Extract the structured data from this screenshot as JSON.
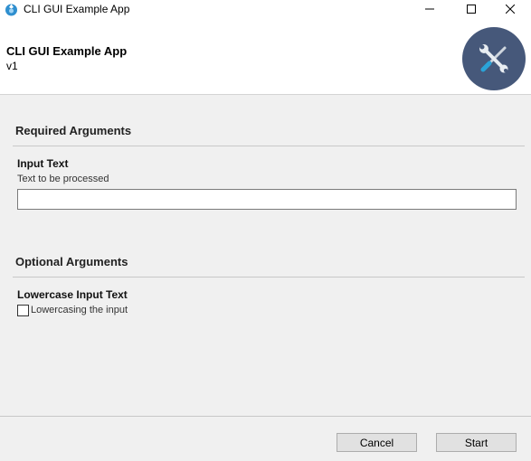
{
  "window": {
    "title": "CLI GUI Example App",
    "icons": {
      "app": "app-logo-icon",
      "minimize": "minimize-icon",
      "maximize": "maximize-icon",
      "close": "close-icon"
    }
  },
  "header": {
    "title": "CLI GUI Example App",
    "version": "v1",
    "logo_icon": "wrench-screwdriver-icon",
    "logo_bg": "#46587a"
  },
  "required": {
    "section_title": "Required Arguments",
    "input_text": {
      "label": "Input Text",
      "help": "Text to be processed",
      "value": ""
    }
  },
  "optional": {
    "section_title": "Optional Arguments",
    "lowercase": {
      "label": "Lowercase Input Text",
      "checkbox_label": "Lowercasing the input",
      "checked": false
    }
  },
  "footer": {
    "cancel_label": "Cancel",
    "start_label": "Start"
  }
}
